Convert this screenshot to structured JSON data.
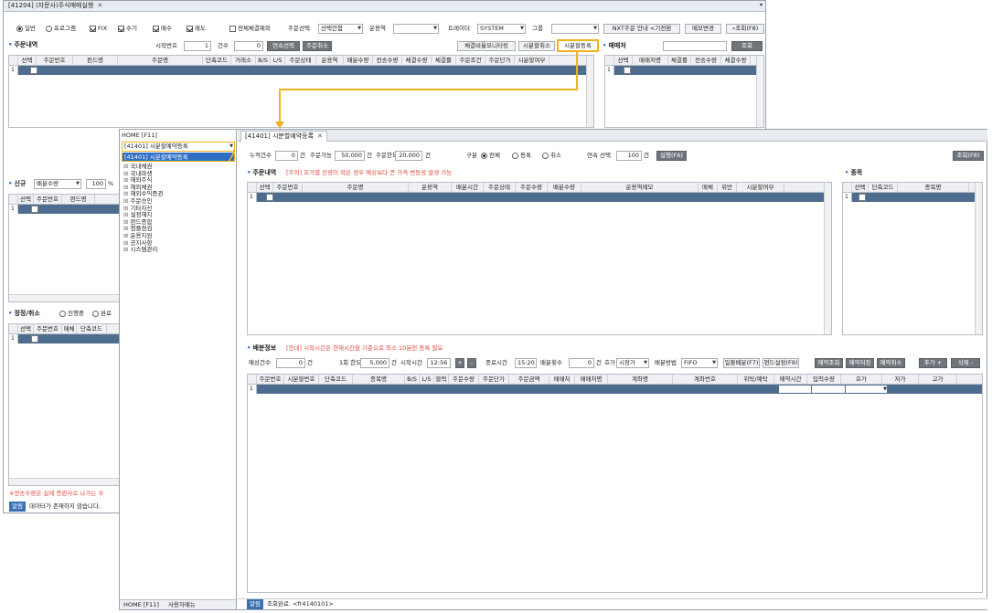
{
  "back_window": {
    "tab_title": "[41204] (자문사)주식매매실행",
    "options": {
      "radio_general": "일반",
      "radio_program": "프로그램",
      "chk_fix": "FIX",
      "chk_manual": "수기",
      "chk_buy": "매수",
      "chk_sell": "매도",
      "chk_exclude_all": "전체체결제외",
      "order_select_label": "주문선택",
      "order_select_value": "선택안함",
      "fund_label": "운용역",
      "trader_label": "트레이더",
      "trader_value": "SYSTEM",
      "group_label": "그룹",
      "nxt_button": "NXT주문 안내 <기전환",
      "memo_button": "메모변경",
      "search_button": "조회(F8)"
    },
    "order_history": {
      "title": "주문내역",
      "start_no_label": "시작번호",
      "start_no_value": "1",
      "count_label": "건수",
      "count_value": "0",
      "btn_continuous": "연속선택",
      "btn_cancel": "주문취소",
      "btn_monitor": "체결비율모니터링",
      "btn_split_cancel": "시분할취소",
      "btn_split_register": "시분할등록",
      "columns": [
        "선택",
        "주문번호",
        "펀드명",
        "주문명",
        "단축코드",
        "거래소",
        "B/S",
        "L/S",
        "주문상태",
        "운용역",
        "배분수량",
        "전송수량",
        "체결수량",
        "체결률",
        "주문조건",
        "주문단가",
        "시분할여부"
      ],
      "row_num": "1"
    },
    "broker": {
      "title": "매매처",
      "search_button": "조회",
      "columns": [
        "선택",
        "매매처명",
        "체결률",
        "전송수량",
        "체결수량"
      ],
      "row_num": "1"
    },
    "new_order": {
      "title": "신규",
      "select_value": "배분수량",
      "pct_value": "100",
      "pct_unit": "%",
      "columns": [
        "선택",
        "주문번호",
        "펀드명"
      ],
      "row_num": "1"
    },
    "modify_cancel": {
      "title": "정정/취소",
      "radio_in_progress": "진행중",
      "radio_done": "완료",
      "columns": [
        "선택",
        "주문번호",
        "매체",
        "단축코드"
      ],
      "row_num": "1"
    },
    "footer_warning": "※전송수량은 실제 증권사로 나가는 수",
    "status_badge": "알림",
    "status_text": "데이터가 존재하지 않습니다."
  },
  "front_window": {
    "sidebar": {
      "home_tab": "HOME [F11]",
      "dropdown_value": "[41401] 시분할예약등록",
      "highlight_item": "[41401] 시분할예약등록",
      "tree_items": [
        "국내채권",
        "국내파생",
        "해외주식",
        "해외채권",
        "해외수익증권",
        "주문승인",
        "기타자산",
        "설정해지",
        "펀드종합",
        "컴플점검",
        "운용지원",
        "공지사항",
        "시스템관리"
      ],
      "bottom_home": "HOME [F11]",
      "bottom_user": "사용자메뉴"
    },
    "tab_title": "[41401] 시분할예약등록",
    "toolbar": {
      "total_count_label": "누적건수",
      "total_count_value": "0",
      "unit_count": "건",
      "order_avail_label": "주문가능",
      "order_avail_value": "50,000",
      "order_limit_label": "주문한도",
      "order_limit_value": "20,000",
      "type_label": "구분",
      "radio_all": "전체",
      "radio_register": "등록",
      "radio_cancel": "취소",
      "continuous_label": "연속 선택",
      "continuous_value": "100",
      "execute_button": "실행(F6)",
      "search_button": "조회(F8)"
    },
    "order_list": {
      "title": "주문내역",
      "notice": "[주의] 호가별 잔량이 작은 경우 예상보다 큰 가격 변동성 발생 가능",
      "columns": [
        "선택",
        "주문번호",
        "주문명",
        "운용역",
        "배분시간",
        "주문상태",
        "주문수량",
        "배분수량",
        "운용역메모",
        "매체",
        "위반",
        "시분할여부"
      ],
      "row_num": "1"
    },
    "items": {
      "title": "종목",
      "columns": [
        "선택",
        "단축코드",
        "종목명"
      ],
      "row_num": "1"
    },
    "distribution": {
      "title": "배분정보",
      "notice": "[안내] 시작시간은 현재시간을 기준으로 최소 10분전 등록 필요",
      "expected_count_label": "예상건수",
      "expected_count_value": "0",
      "per_limit_label": "1회 한도",
      "per_limit_value": "5,000",
      "start_time_label": "시작시간",
      "start_time_value": "12:56",
      "end_time_label": "종료시간",
      "end_time_value": "15:20",
      "dist_count_label": "배분횟수",
      "dist_count_value": "0",
      "price_label": "호가",
      "price_value": "시장가",
      "dist_method_label": "배분방법",
      "dist_method_value": "FIFO",
      "btn_bulk": "일괄배분(F7)",
      "btn_fund_set": "펀드설정(F9)",
      "btn_res_search": "예약조회",
      "btn_res_save": "예약저장",
      "btn_res_cancel": "예약취소",
      "btn_add": "추가 +",
      "btn_delete": "삭제 -",
      "columns": [
        "주문번호",
        "시분할번호",
        "단축코드",
        "종목명",
        "B/S",
        "L/S",
        "블럭",
        "주문수량",
        "주문단가",
        "주문금액",
        "매매처",
        "매매처명",
        "계좌명",
        "계좌번호",
        "위탁/예탁",
        "예약시간",
        "입력수량",
        "호가",
        "저가",
        "고가"
      ],
      "row_num": "1"
    },
    "status_badge": "알림",
    "status_text": "조회완료. <fr4140101>"
  },
  "accent_color": "#f2b21b",
  "row_color": "#4e6c8e"
}
